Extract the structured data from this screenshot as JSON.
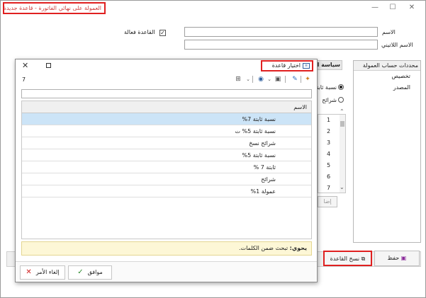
{
  "window": {
    "title": "العمولة على نهائي الفاتورة - قاعدة جديدة",
    "minimize": "—",
    "maximize": "☐",
    "close": "✕"
  },
  "form": {
    "active_rule_label": "القاعدة فعالة",
    "active_rule_checked": true,
    "name_label": "الاسم",
    "latin_name_label": "الاسم اللاتيني",
    "name_value": "",
    "latin_name_value": ""
  },
  "right_panel": {
    "header": "محددات حساب العمولة",
    "items": [
      "تخصيص",
      "المصدر"
    ]
  },
  "middle_panel": {
    "header": "سياسة العمولة",
    "radio1": "نسبة ثابتة",
    "radio2": "شرائح",
    "numbers": [
      "1",
      "2",
      "3",
      "4",
      "5",
      "6",
      "7"
    ],
    "button_partial": "إضا"
  },
  "main_buttons": {
    "copy_rule": "نسخ القاعدة",
    "save": "حفظ"
  },
  "dialog": {
    "title": "اختيار قاعدة",
    "count": "7",
    "search_placeholder": "",
    "grid_header": "الاسم",
    "rows": [
      "نسبة ثابتة 7%",
      "نسبة ثابتة 5% ت",
      "شرائح نسخ",
      "نسبة ثابتة 5%",
      "ثابتة 7 %",
      "شرائح",
      "عمولة 1%"
    ],
    "selected_index": 0,
    "hint_bold": "يحوي:",
    "hint_text": "تبحث ضمن الكلمات.",
    "ok_label": "موافق",
    "cancel_label": "إلغاء الأمر"
  },
  "colors": {
    "highlight_border": "#e02020",
    "selected_row": "#cce4f7",
    "hint_bg": "#fdf7d6"
  }
}
